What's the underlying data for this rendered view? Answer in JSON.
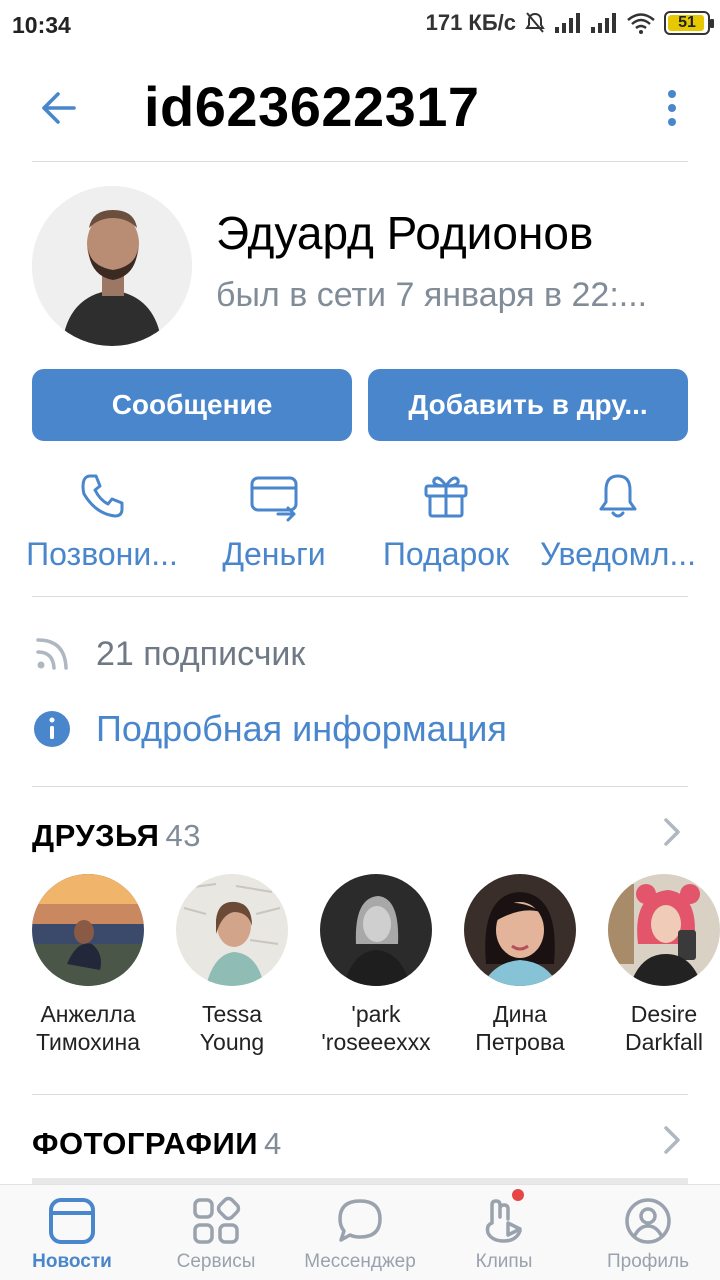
{
  "status_bar": {
    "time": "10:34",
    "speed": "171 КБ/с",
    "battery": "51"
  },
  "header": {
    "title": "id623622317"
  },
  "profile": {
    "name": "Эдуард Родионов",
    "status": "был в сети 7 января в 22:..."
  },
  "buttons": {
    "message": "Сообщение",
    "add_friend": "Добавить в дру..."
  },
  "actions": [
    {
      "label": "Позвони...",
      "icon": "phone-icon"
    },
    {
      "label": "Деньги",
      "icon": "money-card-icon"
    },
    {
      "label": "Подарок",
      "icon": "gift-icon"
    },
    {
      "label": "Уведомл...",
      "icon": "bell-icon"
    }
  ],
  "info": {
    "followers": "21 подписчик",
    "details": "Подробная информация"
  },
  "friends_section": {
    "title": "ДРУЗЬЯ",
    "count": "43",
    "items": [
      {
        "first": "Анжелла",
        "last": "Тимохина"
      },
      {
        "first": "Tessa",
        "last": "Young"
      },
      {
        "first": "'park",
        "last": "'roseeexxx"
      },
      {
        "first": "Дина",
        "last": "Петрова"
      },
      {
        "first": "Desire",
        "last": "Darkfall"
      }
    ]
  },
  "photos_section": {
    "title": "ФОТОГРАФИИ",
    "count": "4"
  },
  "bottom_nav": [
    {
      "label": "Новости",
      "icon": "news-icon",
      "active": true
    },
    {
      "label": "Сервисы",
      "icon": "services-icon",
      "active": false
    },
    {
      "label": "Мессенджер",
      "icon": "messenger-icon",
      "active": false
    },
    {
      "label": "Клипы",
      "icon": "clips-icon",
      "active": false
    },
    {
      "label": "Профиль",
      "icon": "profile-icon",
      "active": false
    }
  ],
  "colors": {
    "accent": "#4986cc",
    "secondary_text": "#818c99",
    "notification_dot": "#e64646"
  }
}
